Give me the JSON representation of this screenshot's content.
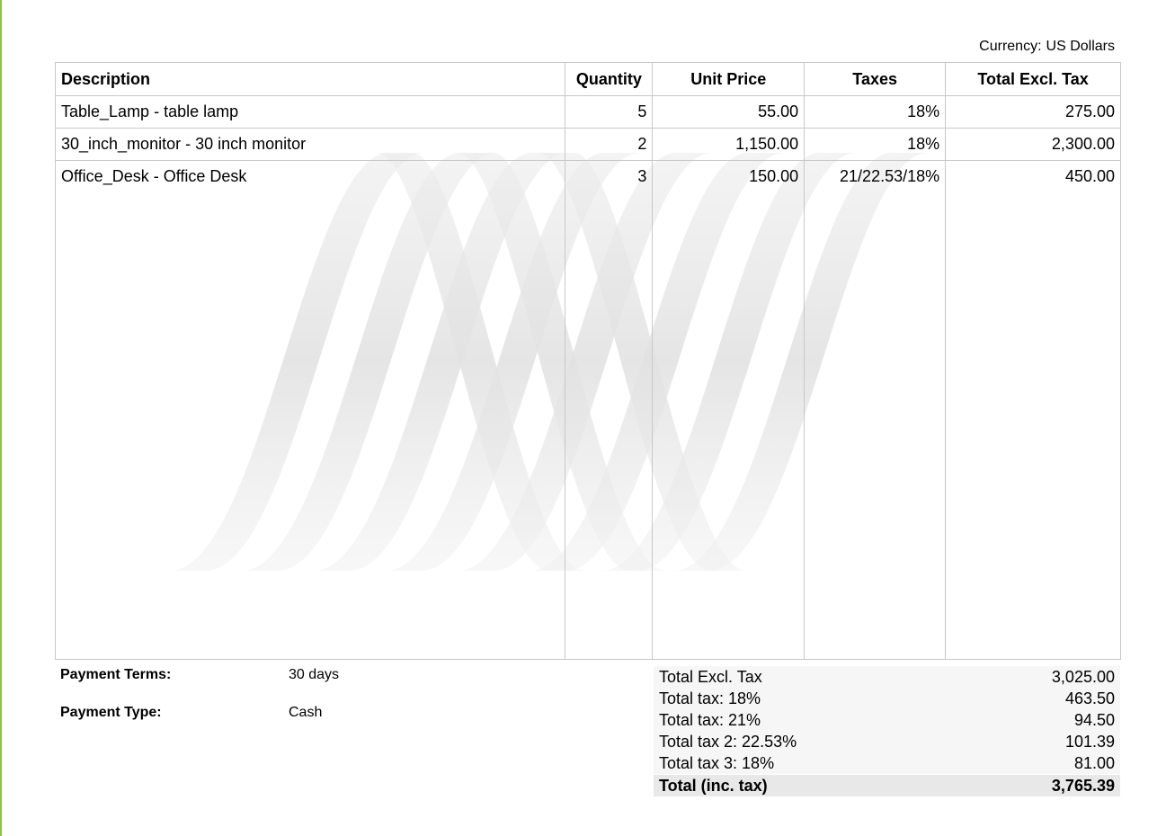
{
  "currency": {
    "label": "Currency:",
    "value": "US Dollars"
  },
  "table": {
    "headers": [
      "Description",
      "Quantity",
      "Unit Price",
      "Taxes",
      "Total Excl. Tax"
    ],
    "rows": [
      {
        "description": "Table_Lamp - table lamp",
        "quantity": "5",
        "unit_price": "55.00",
        "taxes": "18%",
        "total": "275.00"
      },
      {
        "description": "30_inch_monitor - 30 inch monitor",
        "quantity": "2",
        "unit_price": "1,150.00",
        "taxes": "18%",
        "total": "2,300.00"
      },
      {
        "description": "Office_Desk - Office Desk",
        "quantity": "3",
        "unit_price": "150.00",
        "taxes": "21/22.53/18%",
        "total": "450.00"
      }
    ]
  },
  "payment": {
    "terms_label": "Payment Terms:",
    "terms_value": "30 days",
    "type_label": "Payment Type:",
    "type_value": "Cash"
  },
  "totals": [
    {
      "label": "Total Excl. Tax",
      "value": "3,025.00"
    },
    {
      "label": "Total tax: 18%",
      "value": "463.50"
    },
    {
      "label": "Total tax: 21%",
      "value": "94.50"
    },
    {
      "label": "Total tax 2: 22.53%",
      "value": "101.39"
    },
    {
      "label": "Total tax 3: 18%",
      "value": "81.00"
    }
  ],
  "grand_total": {
    "label": "Total (inc. tax)",
    "value": "3,765.39"
  },
  "colors": {
    "accent_rule": "#8bc34a",
    "watermark": "#e4e4e4",
    "grid": "#c8c8c8"
  }
}
